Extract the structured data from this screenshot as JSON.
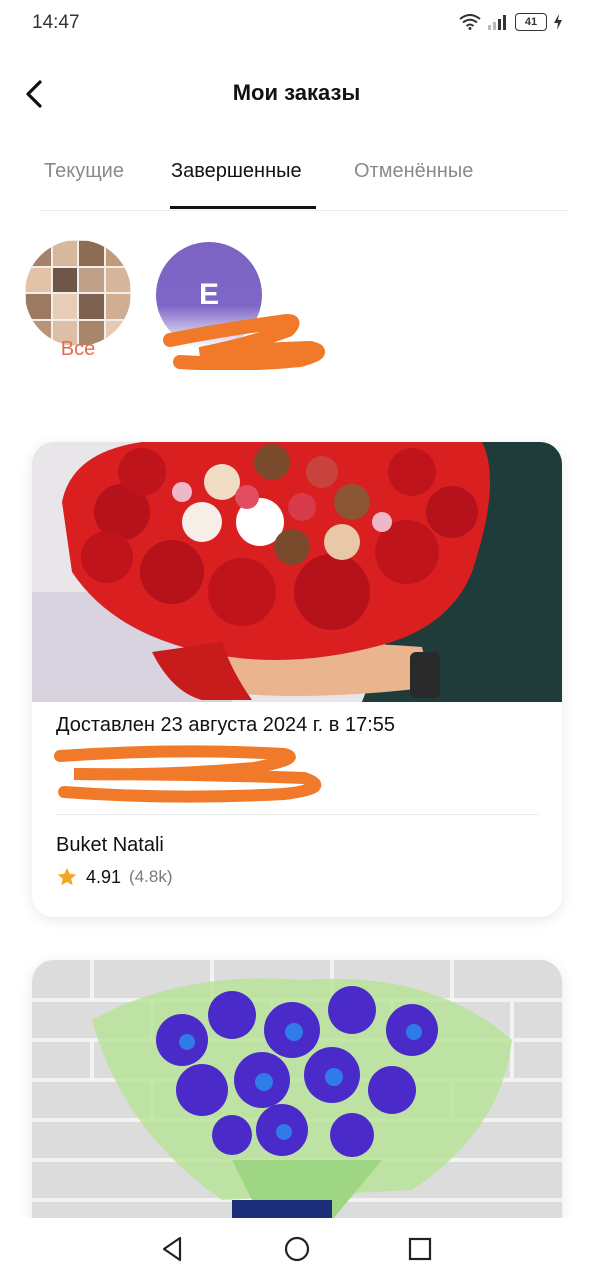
{
  "status_bar": {
    "time": "14:47",
    "battery": "41"
  },
  "header": {
    "title": "Мои заказы",
    "back_icon": "chevron-left-icon"
  },
  "tabs": [
    {
      "label": "Текущие",
      "active": false
    },
    {
      "label": "Завершенные",
      "active": true
    },
    {
      "label": "Отменённые",
      "active": false
    }
  ],
  "stores": {
    "all_label": "Все",
    "store_initial": "E"
  },
  "orders": [
    {
      "status": "Доставлен 23 августа 2024 г. в 17:55",
      "shop_name": "Buket Natali",
      "rating": "4.91",
      "rating_count": "(4.8k)"
    }
  ],
  "colors": {
    "accent": "#e8694d",
    "store_avatar": "#7b64c4",
    "star": "#f5a623",
    "redaction": "#f07a2a"
  },
  "nav": {
    "back": "triangle-back-icon",
    "home": "circle-home-icon",
    "recents": "square-recents-icon"
  }
}
